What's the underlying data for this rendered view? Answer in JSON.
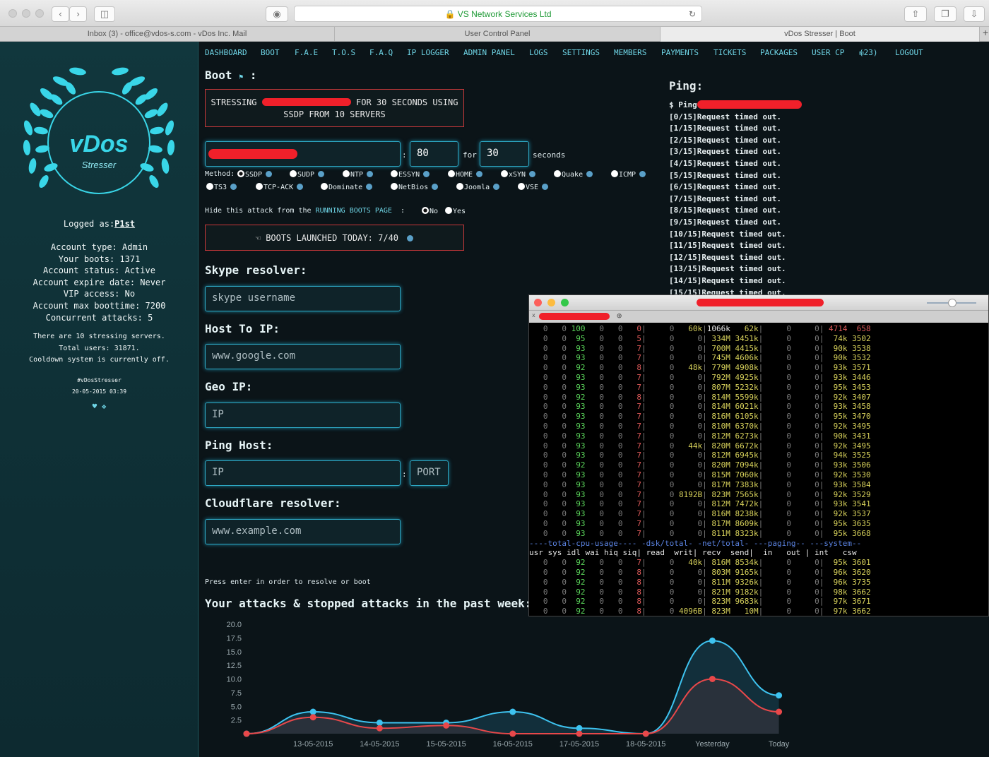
{
  "browser": {
    "address": "VS Network Services Ltd",
    "tabs": [
      "Inbox (3) - office@vdos-s.com - vDos Inc. Mail",
      "User Control Panel",
      "vDos Stresser | Boot"
    ]
  },
  "sidebar": {
    "logo_title": "vDos",
    "logo_subtitle": "Stresser",
    "logged_as_label": "Logged as:",
    "logged_as_user": "P1st",
    "account_lines": [
      "Account type: Admin",
      "Your boots: 1371",
      "Account status: Active",
      "Account expire date: Never",
      "VIP access: No",
      "Account max boottime: 7200",
      "Concurrent attacks: 5"
    ],
    "server_lines": [
      "There are 10 stressing servers.",
      "Total users: 31871.",
      "Cooldown system is currently off."
    ],
    "hashtag": "#vDosStresser",
    "datetime": "20-05-2015 03:39"
  },
  "nav": [
    "DASHBOARD",
    "BOOT",
    "F.A.E",
    "T.O.S",
    "F.A.Q",
    "IP LOGGER",
    "ADMIN PANEL",
    "LOGS",
    "SETTINGS",
    "MEMBERS",
    "PAYMENTS",
    "TICKETS",
    "PACKAGES",
    "USER CP",
    "(23)",
    "LOGOUT"
  ],
  "boot": {
    "title": "Boot",
    "colon": ":",
    "status_line1_a": "STRESSING",
    "status_line1_b": "FOR 30 SECONDS USING",
    "status_line2": "SSDP FROM 10 SERVERS",
    "port_value": "80",
    "for_label": "for",
    "time_value": "30",
    "seconds_label": "seconds",
    "method_label": "Method:",
    "methods_row1": [
      "SSDP",
      "SUDP",
      "NTP",
      "ESSYN",
      "HOME",
      "xSYN",
      "Quake",
      "ICMP"
    ],
    "methods_row2": [
      "TS3",
      "TCP-ACK",
      "Dominate",
      "NetBios",
      "Joomla",
      "VSE"
    ],
    "hide_label_a": "Hide this attack from the",
    "hide_label_link": "RUNNING BOOTS PAGE",
    "hide_label_b": ":",
    "hide_no": "No",
    "hide_yes": "Yes",
    "launched_today": "BOOTS LAUNCHED TODAY: 7/40"
  },
  "skype": {
    "title": "Skype resolver:",
    "placeholder": "skype username"
  },
  "host_to_ip": {
    "title": "Host To IP:",
    "placeholder": "www.google.com"
  },
  "geo_ip": {
    "title": "Geo IP:",
    "placeholder": "IP"
  },
  "ping_host": {
    "title": "Ping Host:",
    "ip_placeholder": "IP",
    "port_placeholder": "PORT",
    "sep": ":"
  },
  "cloudflare": {
    "title": "Cloudflare resolver:",
    "placeholder": "www.example.com"
  },
  "press_enter": "Press enter in order to resolve or boot",
  "attacks_title": "Your attacks & stopped attacks in the past week:",
  "ping": {
    "title": "Ping:",
    "cmd": "$ Ping",
    "lines": [
      "[0/15]Request timed out.",
      "[1/15]Request timed out.",
      "[2/15]Request timed out.",
      "[3/15]Request timed out.",
      "[4/15]Request timed out.",
      "[5/15]Request timed out.",
      "[6/15]Request timed out.",
      "[7/15]Request timed out.",
      "[8/15]Request timed out.",
      "[9/15]Request timed out.",
      "[10/15]Request timed out.",
      "[11/15]Request timed out.",
      "[12/15]Request timed out.",
      "[13/15]Request timed out.",
      "[14/15]Request timed out.",
      "[15/15]Request timed out."
    ]
  },
  "terminal": {
    "rows_top": [
      [
        "0",
        "0",
        "100",
        "0",
        "0",
        "0",
        "0",
        "60k",
        "1066k",
        "62k",
        "0",
        "0",
        "4714",
        "658"
      ],
      [
        "0",
        "0",
        "95",
        "0",
        "0",
        "5",
        "0",
        "0",
        "334M",
        "3451k",
        "0",
        "0",
        "74k",
        "3502"
      ],
      [
        "0",
        "0",
        "93",
        "0",
        "0",
        "7",
        "0",
        "0",
        "700M",
        "4415k",
        "0",
        "0",
        "90k",
        "3538"
      ],
      [
        "0",
        "0",
        "93",
        "0",
        "0",
        "7",
        "0",
        "0",
        "745M",
        "4606k",
        "0",
        "0",
        "90k",
        "3532"
      ],
      [
        "0",
        "0",
        "92",
        "0",
        "0",
        "8",
        "0",
        "48k",
        "779M",
        "4908k",
        "0",
        "0",
        "93k",
        "3571"
      ],
      [
        "0",
        "0",
        "93",
        "0",
        "0",
        "7",
        "0",
        "0",
        "792M",
        "4925k",
        "0",
        "0",
        "93k",
        "3446"
      ],
      [
        "0",
        "0",
        "93",
        "0",
        "0",
        "7",
        "0",
        "0",
        "807M",
        "5232k",
        "0",
        "0",
        "95k",
        "3453"
      ],
      [
        "0",
        "0",
        "92",
        "0",
        "0",
        "8",
        "0",
        "0",
        "814M",
        "5599k",
        "0",
        "0",
        "92k",
        "3407"
      ],
      [
        "0",
        "0",
        "93",
        "0",
        "0",
        "7",
        "0",
        "0",
        "814M",
        "6021k",
        "0",
        "0",
        "93k",
        "3458"
      ],
      [
        "0",
        "0",
        "93",
        "0",
        "0",
        "7",
        "0",
        "0",
        "816M",
        "6105k",
        "0",
        "0",
        "95k",
        "3470"
      ],
      [
        "0",
        "0",
        "93",
        "0",
        "0",
        "7",
        "0",
        "0",
        "810M",
        "6370k",
        "0",
        "0",
        "92k",
        "3495"
      ],
      [
        "0",
        "0",
        "93",
        "0",
        "0",
        "7",
        "0",
        "0",
        "812M",
        "6273k",
        "0",
        "0",
        "90k",
        "3431"
      ],
      [
        "0",
        "0",
        "93",
        "0",
        "0",
        "7",
        "0",
        "44k",
        "820M",
        "6672k",
        "0",
        "0",
        "92k",
        "3495"
      ],
      [
        "0",
        "0",
        "93",
        "0",
        "0",
        "7",
        "0",
        "0",
        "812M",
        "6945k",
        "0",
        "0",
        "94k",
        "3525"
      ],
      [
        "0",
        "0",
        "92",
        "0",
        "0",
        "7",
        "0",
        "0",
        "820M",
        "7094k",
        "0",
        "0",
        "93k",
        "3506"
      ],
      [
        "0",
        "0",
        "93",
        "0",
        "0",
        "7",
        "0",
        "0",
        "815M",
        "7060k",
        "0",
        "0",
        "92k",
        "3530"
      ],
      [
        "0",
        "0",
        "93",
        "0",
        "0",
        "7",
        "0",
        "0",
        "817M",
        "7383k",
        "0",
        "0",
        "93k",
        "3584"
      ],
      [
        "0",
        "0",
        "93",
        "0",
        "0",
        "7",
        "0",
        "8192B",
        "823M",
        "7565k",
        "0",
        "0",
        "92k",
        "3529"
      ],
      [
        "0",
        "0",
        "93",
        "0",
        "0",
        "7",
        "0",
        "0",
        "812M",
        "7472k",
        "0",
        "0",
        "93k",
        "3541"
      ],
      [
        "0",
        "0",
        "93",
        "0",
        "0",
        "7",
        "0",
        "0",
        "816M",
        "8238k",
        "0",
        "0",
        "92k",
        "3537"
      ],
      [
        "0",
        "0",
        "93",
        "0",
        "0",
        "7",
        "0",
        "0",
        "817M",
        "8609k",
        "0",
        "0",
        "95k",
        "3635"
      ],
      [
        "0",
        "0",
        "93",
        "0",
        "0",
        "7",
        "0",
        "0",
        "811M",
        "8323k",
        "0",
        "0",
        "95k",
        "3668"
      ]
    ],
    "group_header": "----total-cpu-usage---- -dsk/total- -net/total- ---paging-- ---system--",
    "col_header": "usr sys idl wai hiq siq| read  writ| recv  send|  in   out | int   csw",
    "rows_bottom": [
      [
        "0",
        "0",
        "92",
        "0",
        "0",
        "7",
        "0",
        "40k",
        "816M",
        "8534k",
        "0",
        "0",
        "95k",
        "3601"
      ],
      [
        "0",
        "0",
        "92",
        "0",
        "0",
        "8",
        "0",
        "0",
        "803M",
        "9165k",
        "0",
        "0",
        "96k",
        "3620"
      ],
      [
        "0",
        "0",
        "92",
        "0",
        "0",
        "8",
        "0",
        "0",
        "811M",
        "9326k",
        "0",
        "0",
        "96k",
        "3735"
      ],
      [
        "0",
        "0",
        "92",
        "0",
        "0",
        "8",
        "0",
        "0",
        "821M",
        "9182k",
        "0",
        "0",
        "98k",
        "3662"
      ],
      [
        "0",
        "0",
        "92",
        "0",
        "0",
        "8",
        "0",
        "0",
        "823M",
        "9683k",
        "0",
        "0",
        "97k",
        "3671"
      ],
      [
        "0",
        "0",
        "92",
        "0",
        "0",
        "8",
        "0",
        "4096B",
        "823M",
        "10M",
        "0",
        "0",
        "97k",
        "3662"
      ]
    ]
  },
  "chart_data": {
    "type": "area",
    "categories": [
      "13-05-2015",
      "14-05-2015",
      "15-05-2015",
      "16-05-2015",
      "17-05-2015",
      "18-05-2015",
      "Yesterday",
      "Today"
    ],
    "yticks": [
      "20.0",
      "17.5",
      "15.0",
      "12.5",
      "10.0",
      "7.5",
      "5.0",
      "2.5"
    ],
    "ylim": [
      0,
      20
    ],
    "x_start": "13-05-2015",
    "series": [
      {
        "color": "#3ec3f0",
        "values": [
          0,
          4,
          2,
          2,
          4,
          1,
          0,
          17,
          7
        ]
      },
      {
        "color": "#e8484a",
        "values": [
          0,
          3,
          1,
          1.5,
          0,
          0,
          0,
          10,
          4
        ]
      }
    ]
  }
}
